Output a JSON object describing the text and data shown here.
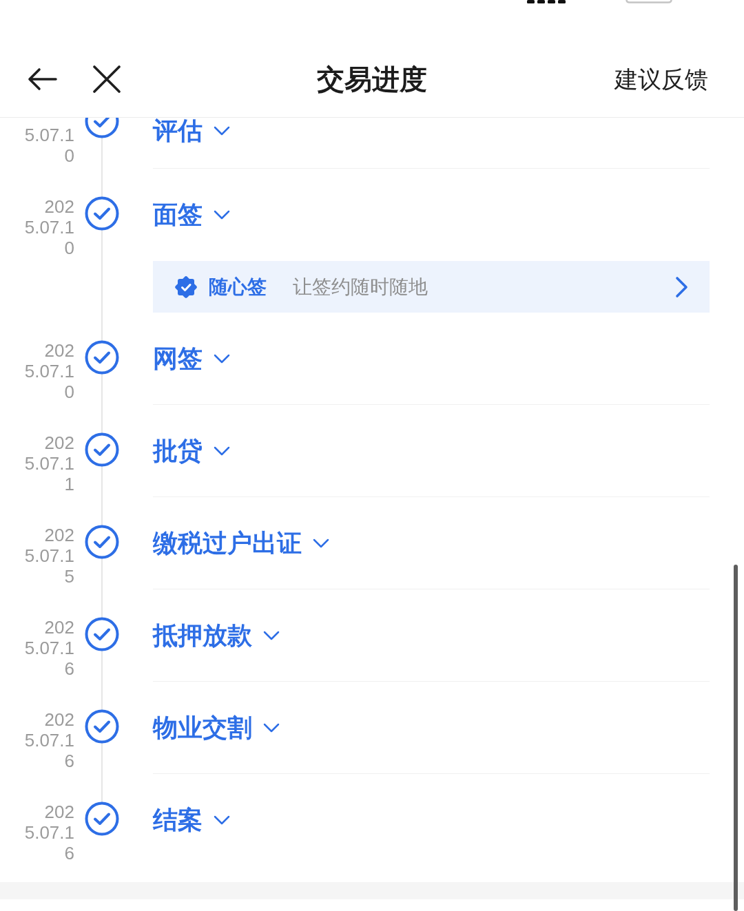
{
  "header": {
    "title": "交易进度",
    "action": "建议反馈"
  },
  "timeline": [
    {
      "date": "5.07.10",
      "title": "评估",
      "done": true,
      "expanded": false
    },
    {
      "date": "2025.07.10",
      "title": "面签",
      "done": true,
      "expanded": false,
      "promo": {
        "name": "随心签",
        "tagline": "让签约随时随地"
      }
    },
    {
      "date": "2025.07.10",
      "title": "网签",
      "done": true,
      "expanded": false
    },
    {
      "date": "2025.07.11",
      "title": "批贷",
      "done": true,
      "expanded": false
    },
    {
      "date": "2025.07.15",
      "title": "缴税过户出证",
      "done": true,
      "expanded": false
    },
    {
      "date": "2025.07.16",
      "title": "抵押放款",
      "done": true,
      "expanded": false
    },
    {
      "date": "2025.07.16",
      "title": "物业交割",
      "done": true,
      "expanded": false
    },
    {
      "date": "2025.07.16",
      "title": "结案",
      "done": true,
      "expanded": false
    }
  ]
}
